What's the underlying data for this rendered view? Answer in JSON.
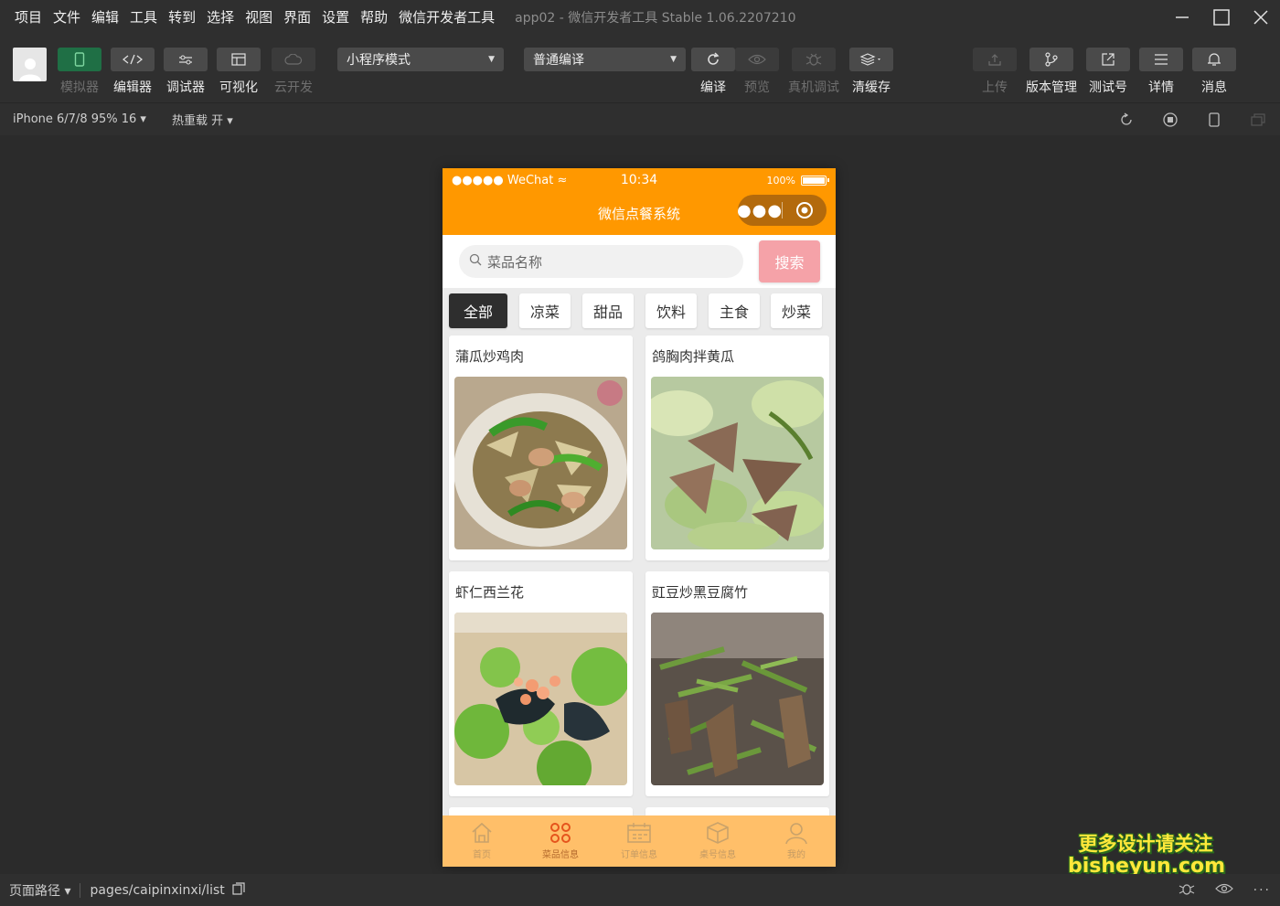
{
  "menu": [
    "项目",
    "文件",
    "编辑",
    "工具",
    "转到",
    "选择",
    "视图",
    "界面",
    "设置",
    "帮助",
    "微信开发者工具"
  ],
  "window_title": "app02 - 微信开发者工具 Stable 1.06.2207210",
  "toolbar": {
    "simulator": "模拟器",
    "editor": "编辑器",
    "debugger": "调试器",
    "visual": "可视化",
    "cloud": "云开发",
    "mode_select": "小程序模式",
    "compile_select": "普通编译",
    "compile": "编译",
    "preview": "预览",
    "remote_debug": "真机调试",
    "clear_cache": "清缓存",
    "upload": "上传",
    "version": "版本管理",
    "test_account": "测试号",
    "details": "详情",
    "messages": "消息"
  },
  "subbar": {
    "device": "iPhone 6/7/8 95% 16",
    "hot_reload": "热重载 开"
  },
  "phone": {
    "status": {
      "carrier": "●●●●● WeChat",
      "time": "10:34",
      "battery": "100%"
    },
    "nav_title": "微信点餐系统",
    "search": {
      "placeholder": "菜品名称",
      "button": "搜索"
    },
    "categories": [
      "全部",
      "凉菜",
      "甜品",
      "饮料",
      "主食",
      "炒菜"
    ],
    "dishes": [
      {
        "name": "蒲瓜炒鸡肉",
        "icon": "dish-photo"
      },
      {
        "name": "鸽胸肉拌黄瓜",
        "icon": "dish-photo"
      },
      {
        "name": "虾仁西兰花",
        "icon": "dish-photo"
      },
      {
        "name": "豇豆炒黑豆腐竹",
        "icon": "dish-photo"
      }
    ],
    "tabs": [
      "首页",
      "菜品信息",
      "订单信息",
      "桌号信息",
      "我的"
    ]
  },
  "bottom": {
    "page_path_label": "页面路径",
    "page_path": "pages/caipinxinxi/list"
  },
  "watermark": {
    "line1": "更多设计请关注",
    "line2": "bisheyun.com"
  },
  "colors": {
    "accent": "#ff9800",
    "tabbar": "#ffbf69",
    "search_button": "#f5a2a8",
    "active_tab": "#e5541c"
  }
}
